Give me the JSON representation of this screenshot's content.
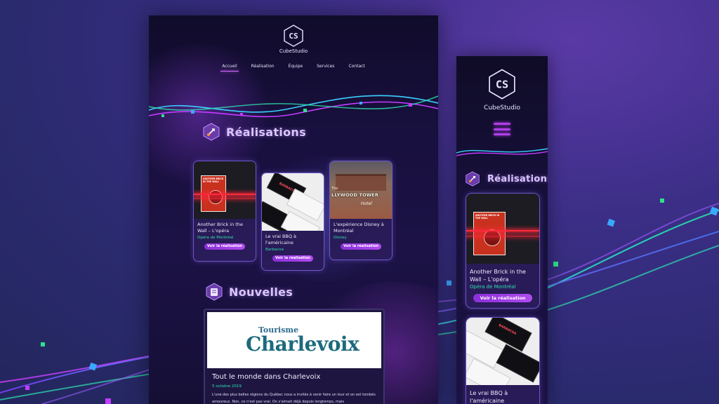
{
  "brand": {
    "logo_text": "CS",
    "name": "CubeStudio"
  },
  "nav": {
    "items": [
      {
        "label": "Accueil",
        "active": true
      },
      {
        "label": "Réalisation"
      },
      {
        "label": "Équipe"
      },
      {
        "label": "Services"
      },
      {
        "label": "Contact"
      }
    ]
  },
  "realisations": {
    "title": "Réalisations",
    "button_label": "Voir la réalisation",
    "cards": [
      {
        "title": "Another Brick in the Wall – L'opéra",
        "client": "Opéra de Montréal",
        "poster_text": "ANOTHER BRICK IN THE WALL"
      },
      {
        "title": "Le vrai BBQ à l'américaine",
        "client": "Barbacoa",
        "label": "BARBACOA"
      },
      {
        "title": "L'expérience Disney à Montréal",
        "client": "Disney",
        "sign_the": "The",
        "sign_main": "LLYWOOD TOWER",
        "sign_sub": "Hotel"
      }
    ]
  },
  "nouvelles": {
    "title": "Nouvelles",
    "image_text_top": "Tourisme",
    "image_text_main": "Charlevoix",
    "post_title": "Tout le monde dans Charlevoix",
    "post_date": "5 octobre 2019",
    "post_body": "L'une des plus belles régions du Québec nous a invités à venir faire un tour et on est tombés amoureux. Non, ce n'est pas vrai. On s'aimait déjà depuis longtemps, mais"
  },
  "mobile": {
    "menu_icon": "hamburger-icon",
    "cards": [
      {
        "title": "Another Brick in the Wall – L'opéra",
        "client": "Opéra de Montréal"
      },
      {
        "title": "Le vrai BBQ à l'américaine"
      }
    ]
  },
  "colors": {
    "accent": "#b13ee8",
    "client": "#2fe0b0",
    "laser": "#ff2a3c"
  }
}
